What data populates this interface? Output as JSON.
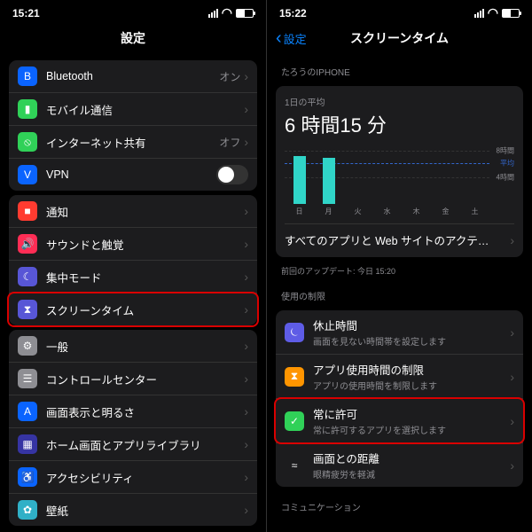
{
  "left": {
    "time": "15:21",
    "title": "設定",
    "rows": [
      {
        "icon": "bluetooth",
        "bg": "#0a64ff",
        "glyph": "B",
        "label": "Bluetooth",
        "value": "オン",
        "chev": true
      },
      {
        "icon": "cellular",
        "bg": "#30d158",
        "glyph": "▮",
        "label": "モバイル通信",
        "chev": true
      },
      {
        "icon": "hotspot",
        "bg": "#30d158",
        "glyph": "⦸",
        "label": "インターネット共有",
        "value": "オフ",
        "chev": true
      },
      {
        "icon": "vpn",
        "bg": "#0a64ff",
        "glyph": "V",
        "label": "VPN",
        "toggle": true
      }
    ],
    "rows2": [
      {
        "icon": "notif",
        "bg": "#ff3b30",
        "glyph": "■",
        "label": "通知",
        "chev": true
      },
      {
        "icon": "sound",
        "bg": "#ff2d55",
        "glyph": "🔊",
        "label": "サウンドと触覚",
        "chev": true
      },
      {
        "icon": "focus",
        "bg": "#5856d6",
        "glyph": "☾",
        "label": "集中モード",
        "chev": true
      },
      {
        "icon": "screentime",
        "bg": "#5856d6",
        "glyph": "⧗",
        "label": "スクリーンタイム",
        "chev": true,
        "hl": true
      }
    ],
    "rows3": [
      {
        "icon": "general",
        "bg": "#8e8e93",
        "glyph": "⚙",
        "label": "一般",
        "chev": true
      },
      {
        "icon": "control",
        "bg": "#8e8e93",
        "glyph": "☰",
        "label": "コントロールセンター",
        "chev": true
      },
      {
        "icon": "display",
        "bg": "#0a64ff",
        "glyph": "A",
        "label": "画面表示と明るさ",
        "chev": true
      },
      {
        "icon": "home",
        "bg": "#3634a3",
        "glyph": "▦",
        "label": "ホーム画面とアプリライブラリ",
        "chev": true
      },
      {
        "icon": "access",
        "bg": "#0a64ff",
        "glyph": "♿",
        "label": "アクセシビリティ",
        "chev": true
      },
      {
        "icon": "wallpaper",
        "bg": "#30b0c7",
        "glyph": "✿",
        "label": "壁紙",
        "chev": true
      }
    ]
  },
  "right": {
    "time": "15:22",
    "back": "設定",
    "title": "スクリーンタイム",
    "owner": "たろうのIPHONE",
    "avg_label": "1日の平均",
    "avg_value": "6 時間15 分",
    "last_update": "前回のアップデート: 今日 15:20",
    "limits_label": "使用の制限",
    "all_apps": "すべてのアプリと Web サイトのアクテ…",
    "comm_label": "コミュニケーション",
    "limits": [
      {
        "icon": "downtime",
        "bg": "#5e5ce6",
        "glyph": "⏾",
        "label": "休止時間",
        "sub": "画面を見ない時間帯を設定します"
      },
      {
        "icon": "applimit",
        "bg": "#ff9500",
        "glyph": "⧗",
        "label": "アプリ使用時間の制限",
        "sub": "アプリの使用時間を制限します"
      },
      {
        "icon": "always",
        "bg": "#30d158",
        "glyph": "✓",
        "label": "常に許可",
        "sub": "常に許可するアプリを選択します",
        "hl": true
      },
      {
        "icon": "distance",
        "bg": "#1c1c1e",
        "glyph": "≈",
        "label": "画面との距離",
        "sub": "眼精疲労を軽減"
      }
    ],
    "y_labels": {
      "top": "8時間",
      "mid": "平均",
      "bot": "4時間"
    }
  },
  "chart_data": {
    "type": "bar",
    "title": "1日の平均 6 時間15 分",
    "categories": [
      "日",
      "月",
      "火",
      "水",
      "木",
      "金",
      "土"
    ],
    "values": [
      7.2,
      7.0,
      0,
      0,
      0,
      0,
      0
    ],
    "ylim": [
      0,
      8
    ],
    "ylabel": "時間",
    "average": 6.25
  }
}
